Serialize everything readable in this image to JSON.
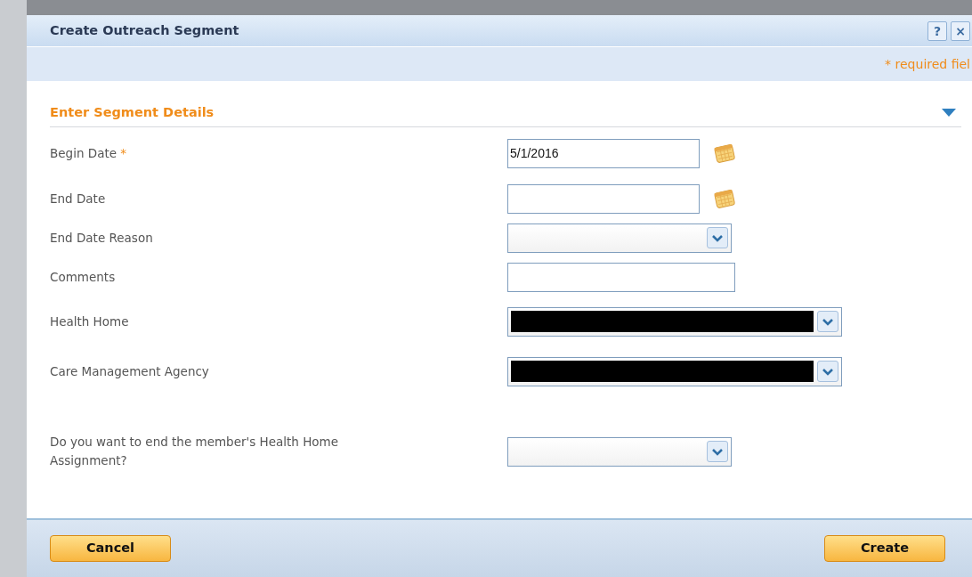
{
  "dialog": {
    "title": "Create Outreach Segment",
    "help_button": "?",
    "close_button": "×",
    "required_note": "* required fiel"
  },
  "section": {
    "title": "Enter Segment Details",
    "expanded": true
  },
  "fields": [
    {
      "label": "Begin Date",
      "required_mark": "*",
      "kind": "date",
      "value": "5/1/2016"
    },
    {
      "label": "End Date",
      "kind": "date"
    },
    {
      "label": "End Date Reason",
      "kind": "select"
    },
    {
      "label": "Comments",
      "kind": "text"
    },
    {
      "label": "Health Home",
      "kind": "select",
      "redacted": true
    },
    {
      "label": "Care Management Agency",
      "kind": "select",
      "redacted": true
    },
    {
      "label": "Do you want to end the member's Health Home Assignment?",
      "kind": "select"
    }
  ],
  "buttons": [
    {
      "label": "Cancel"
    },
    {
      "label": "Create"
    }
  ]
}
